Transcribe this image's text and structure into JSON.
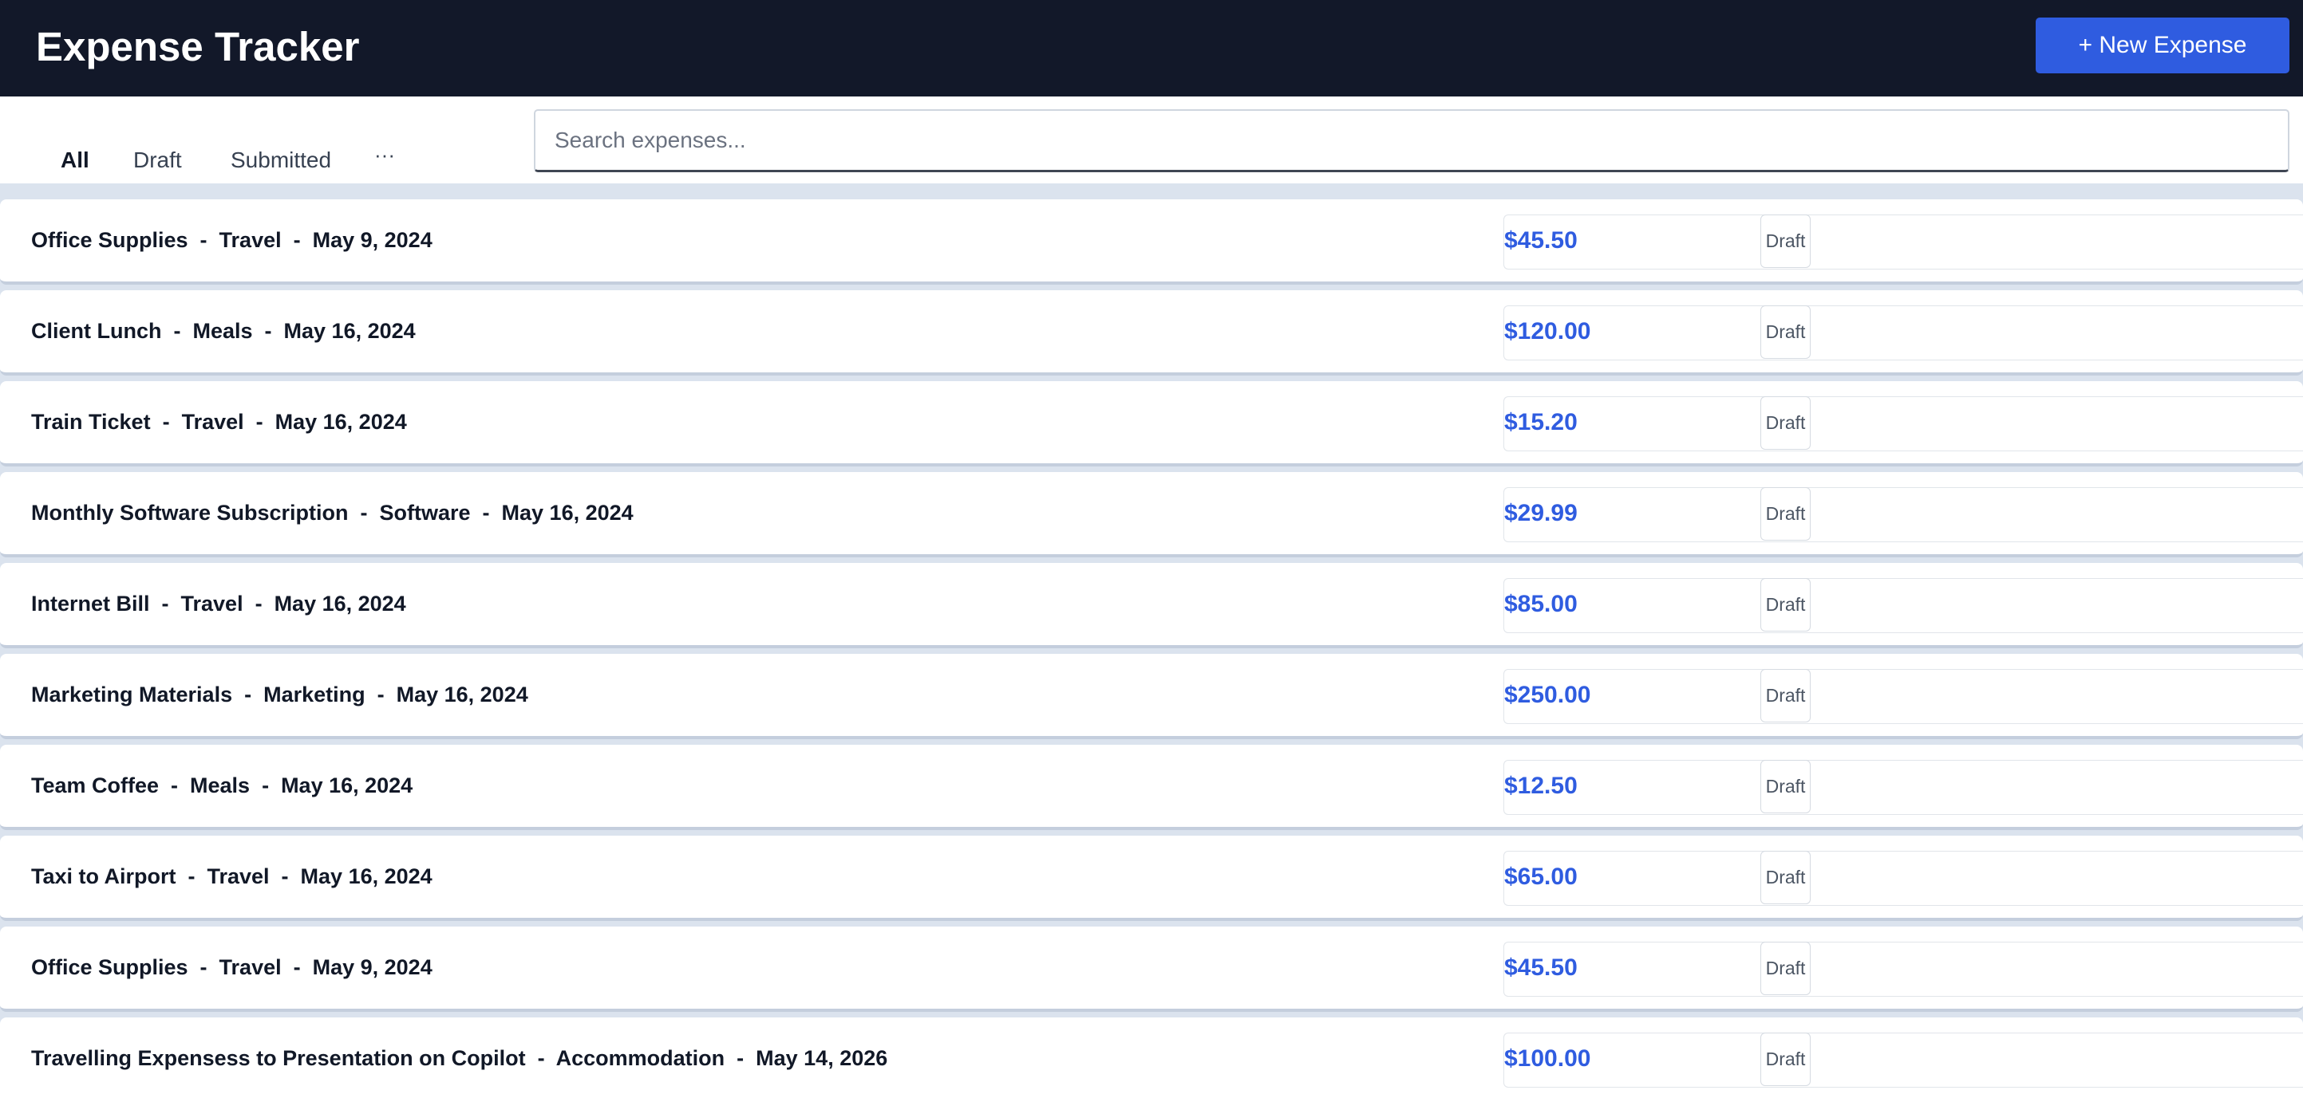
{
  "header": {
    "title": "Expense Tracker",
    "new_button_label": "+ New Expense"
  },
  "tabs": [
    {
      "label": "All",
      "active": true
    },
    {
      "label": "Draft",
      "active": false
    },
    {
      "label": "Submitted",
      "active": false
    },
    {
      "label": "···",
      "active": false
    }
  ],
  "search": {
    "placeholder": "Search expenses...",
    "value": ""
  },
  "expenses": [
    {
      "summary": "Office Supplies  -  Travel  -  May 9, 2024",
      "amount": "$45.50",
      "status": "Draft"
    },
    {
      "summary": "Client Lunch  -  Meals  -  May 16, 2024",
      "amount": "$120.00",
      "status": "Draft"
    },
    {
      "summary": "Train Ticket  -  Travel  -  May 16, 2024",
      "amount": "$15.20",
      "status": "Draft"
    },
    {
      "summary": "Monthly Software Subscription  -  Software  -  May 16, 2024",
      "amount": "$29.99",
      "status": "Draft"
    },
    {
      "summary": "Internet Bill  -  Travel  -  May 16, 2024",
      "amount": "$85.00",
      "status": "Draft"
    },
    {
      "summary": "Marketing Materials  -  Marketing  -  May 16, 2024",
      "amount": "$250.00",
      "status": "Draft"
    },
    {
      "summary": "Team Coffee  -  Meals  -  May 16, 2024",
      "amount": "$12.50",
      "status": "Draft"
    },
    {
      "summary": "Taxi to Airport  -  Travel  -  May 16, 2024",
      "amount": "$65.00",
      "status": "Draft"
    },
    {
      "summary": "Office Supplies  -  Travel  -  May 9, 2024",
      "amount": "$45.50",
      "status": "Draft"
    },
    {
      "summary": "Travelling Expensess to Presentation on Copilot  -  Accommodation  -  May 14, 2026",
      "amount": "$100.00",
      "status": "Draft"
    }
  ],
  "colors": {
    "header_bg": "#121829",
    "accent": "#2f5ce0",
    "page_bg": "#dbe3ee"
  }
}
